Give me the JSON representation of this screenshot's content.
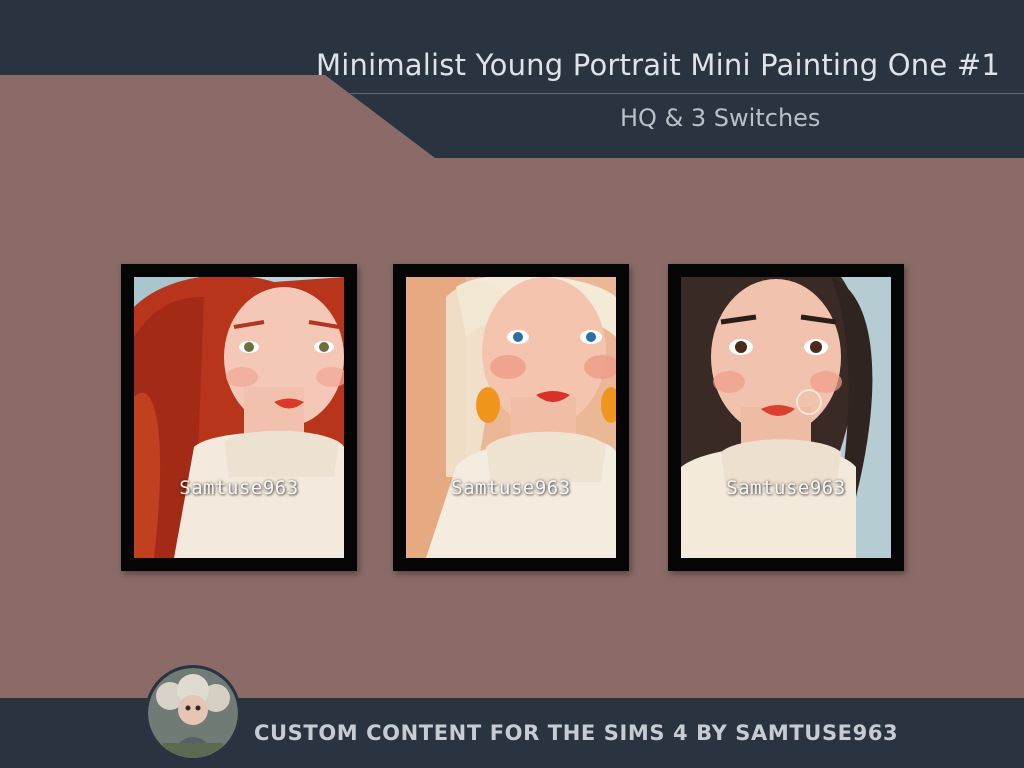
{
  "header": {
    "title": "Minimalist Young Portrait Mini Painting One #1",
    "subtitle": "HQ & 3 Switches"
  },
  "paintings": [
    {
      "watermark": "Samtuse963"
    },
    {
      "watermark": "Samtuse963"
    },
    {
      "watermark": "Samtuse963"
    }
  ],
  "footer": {
    "text": "CUSTOM CONTENT FOR THE SIMS 4 BY SAMTUSE963"
  },
  "colors": {
    "background": "#8a6b68",
    "header_band": "#2a3340",
    "footer_band": "#2a3340",
    "frame": "#050505"
  }
}
